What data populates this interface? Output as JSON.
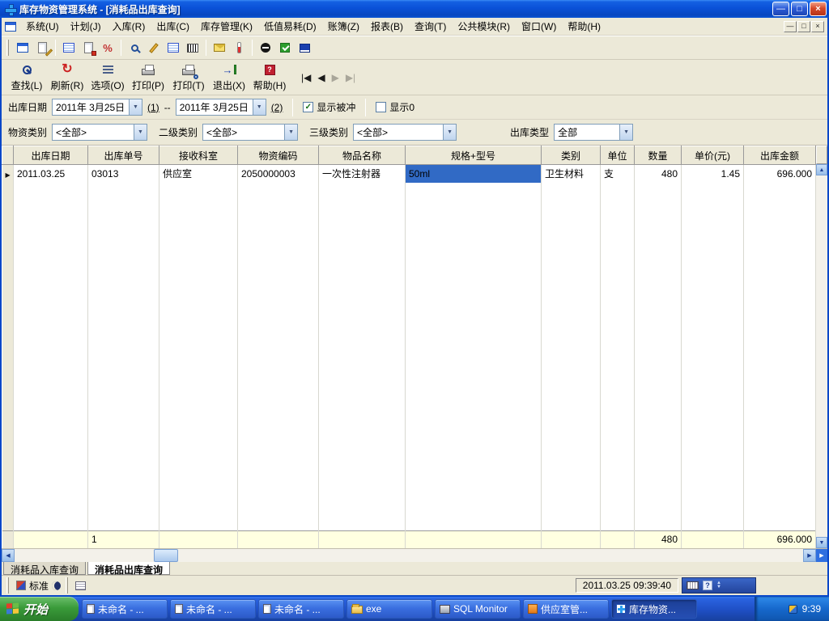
{
  "window": {
    "title": "库存物资管理系统 - [消耗品出库查询]"
  },
  "titlebar": {
    "minimize": "—",
    "maximize": "□",
    "close": "×"
  },
  "mdi": {
    "minimize": "—",
    "restore": "□",
    "close": "×"
  },
  "menubar": {
    "items": [
      "系统(U)",
      "计划(J)",
      "入库(R)",
      "出库(C)",
      "库存管理(K)",
      "低值易耗(D)",
      "账簿(Z)",
      "报表(B)",
      "查询(T)",
      "公共模块(R)",
      "窗口(W)",
      "帮助(H)"
    ]
  },
  "toolbar": {
    "buttons": [
      {
        "label": "查找(L)"
      },
      {
        "label": "刷新(R)"
      },
      {
        "label": "选项(O)"
      },
      {
        "label": "打印(P)"
      },
      {
        "label": "打印(T)"
      },
      {
        "label": "退出(X)"
      },
      {
        "label": "帮助(H)"
      }
    ],
    "nav": {
      "first": "|◀",
      "prev": "◀",
      "next": "▶",
      "last": "▶|"
    }
  },
  "filters": {
    "date_label": "出库日期",
    "date_from": "2011年 3月25日",
    "seq1": "(1)",
    "range_sep": "--",
    "date_to": "2011年 3月25日",
    "seq2": "(2)",
    "show_reversed": "显示被冲",
    "show_zero": "显示0",
    "cat1_label": "物资类别",
    "cat1_value": "<全部>",
    "cat2_label": "二级类别",
    "cat2_value": "<全部>",
    "cat3_label": "三级类别",
    "cat3_value": "<全部>",
    "type_label": "出库类型",
    "type_value": "全部"
  },
  "grid": {
    "headers": [
      "出库日期",
      "出库单号",
      "接收科室",
      "物资编码",
      "物品名称",
      "规格+型号",
      "类别",
      "单位",
      "数量",
      "单价(元)",
      "出库金额"
    ],
    "rows": [
      {
        "cells": [
          "2011.03.25",
          "03013",
          "供应室",
          "2050000003",
          "一次性注射器",
          "50ml",
          "卫生材料",
          "支",
          "480",
          "1.45",
          "696.000"
        ]
      }
    ],
    "summary": {
      "count": "1",
      "qty": "480",
      "amount": "696.000"
    }
  },
  "tabs": [
    {
      "label": "消耗品入库查询"
    },
    {
      "label": "消耗品出库查询"
    }
  ],
  "statusbar": {
    "toolbar_name": "标准",
    "timestamp": "2011.03.25 09:39:40"
  },
  "taskbar": {
    "start": "开始",
    "tasks": [
      "未命名 - ...",
      "未命名 - ...",
      "未命名 - ...",
      "exe",
      "SQL Monitor",
      "供应室管...",
      "库存物资..."
    ],
    "tray_time": "9:39"
  },
  "glyphs": {
    "check": "✓",
    "dropdown": "▼",
    "row_marker": "▶",
    "scroll_left": "◀",
    "scroll_right": "▶",
    "scroll_up": "▲",
    "scroll_down": "▼",
    "refresh": "↻",
    "exit_arrow": "→",
    "question": "?",
    "percent": "%",
    "chev_up": "▲",
    "chev_down": "▼"
  },
  "colors": {
    "titlebar_blue": "#0a51d8",
    "selection_blue": "#316ac5",
    "summary_yellow": "#ffffe1",
    "taskbar_blue": "#1f4fc4",
    "start_green": "#3a9b3a",
    "face": "#ece9d8"
  }
}
